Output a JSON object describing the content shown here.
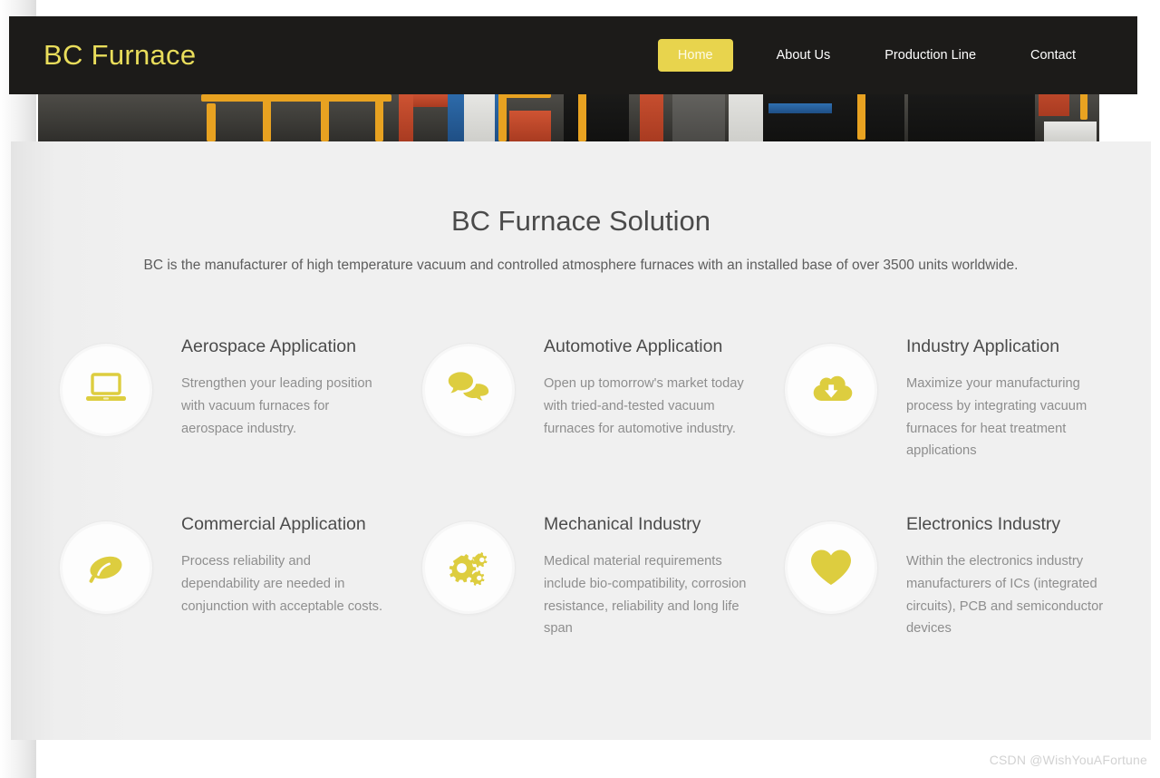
{
  "site": {
    "brand": "BC Furnace",
    "nav": [
      {
        "label": "Home",
        "active": true
      },
      {
        "label": "About Us",
        "active": false
      },
      {
        "label": "Production Line",
        "active": false
      },
      {
        "label": "Contact",
        "active": false
      }
    ]
  },
  "hero": {
    "alt": "Industrial furnace production line photograph"
  },
  "main": {
    "title": "BC Furnace Solution",
    "subtitle": "BC is the manufacturer of high temperature vacuum and controlled atmosphere furnaces with an installed base of over 3500 units worldwide.",
    "cards": [
      {
        "icon": "laptop-icon",
        "title": "Aerospace Application",
        "text": "Strengthen your leading position with vacuum furnaces for aerospace industry."
      },
      {
        "icon": "chat-bubbles-icon",
        "title": "Automotive Application",
        "text": "Open up tomorrow's market today with tried-and-tested vacuum furnaces for automotive industry."
      },
      {
        "icon": "cloud-download-icon",
        "title": "Industry Application",
        "text": "Maximize your manufacturing process by integrating vacuum furnaces for heat treatment applications"
      },
      {
        "icon": "leaf-icon",
        "title": "Commercial Application",
        "text": "Process reliability and dependability are needed in conjunction with acceptable costs."
      },
      {
        "icon": "gears-icon",
        "title": "Mechanical Industry",
        "text": "Medical material requirements include bio-compatibility, corrosion resistance, reliability and long life span"
      },
      {
        "icon": "heart-icon",
        "title": "Electronics Industry",
        "text": "Within the electronics industry manufacturers of ICs (integrated circuits), PCB and semiconductor devices"
      }
    ]
  },
  "watermark": "CSDN @WishYouAFortune",
  "colors": {
    "accent_yellow": "#e8d44d",
    "brand_yellow": "#e9dd5b",
    "nav_background": "#1c1b19",
    "icon_yellow": "#ddcd3f",
    "content_background": "#f0f0f0",
    "heading_text": "#4a4a4a",
    "body_text": "#8e8e8e"
  }
}
